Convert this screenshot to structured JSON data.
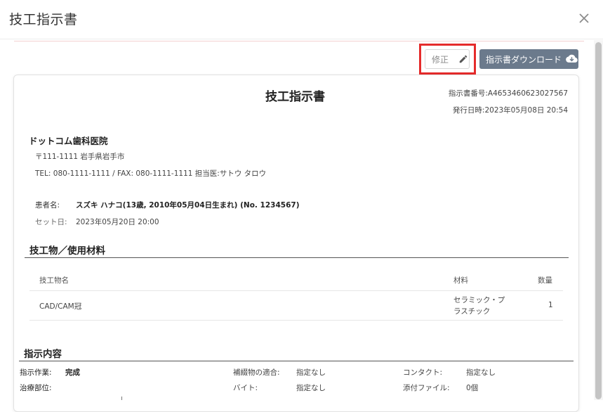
{
  "modal": {
    "title": "技工指示書"
  },
  "toolbar": {
    "edit_label": "修正",
    "download_label": "指示書ダウンロード"
  },
  "doc": {
    "title": "技工指示書",
    "number": "指示書番号:A4653460623027567",
    "issued": "発行日時:2023年05月08日 20:54",
    "clinic": {
      "name": "ドットコム歯科医院",
      "address": "〒111-1111 岩手県岩手市",
      "contact": "TEL: 080-1111-1111 / FAX: 080-1111-1111  担当医:サトウ タロウ"
    },
    "patient": {
      "label": "患者名:",
      "value": "スズキ ハナコ(13歳, 2010年05月04日生まれ) (No. 1234567)",
      "set_label": "セット日:",
      "set_value": "2023年05月20日 20:00"
    },
    "materials": {
      "title": "技工物／使用材料",
      "headers": {
        "name": "技工物名",
        "material": "材料",
        "qty": "数量"
      },
      "rows": [
        {
          "name": "CAD/CAM冠",
          "material_line1": "セラミック・プ",
          "material_line2": "ラスチック",
          "qty": "1"
        }
      ]
    },
    "instructions": {
      "title": "指示内容",
      "work_label": "指示作業:",
      "work_value": "完成",
      "fit_label": "補綴物の適合:",
      "fit_value": "指定なし",
      "contact_label": "コンタクト:",
      "contact_value": "指定なし",
      "site_label": "治療部位:",
      "bite_label": "バイト:",
      "bite_value": "指定なし",
      "attach_label": "添付ファイル:",
      "attach_value": "0個"
    }
  },
  "icons": {
    "close": "close-icon",
    "edit": "pencil-icon",
    "download": "cloud-download-icon"
  },
  "colors": {
    "download_button": "#6b7a8c",
    "highlight": "#e52b2b"
  }
}
